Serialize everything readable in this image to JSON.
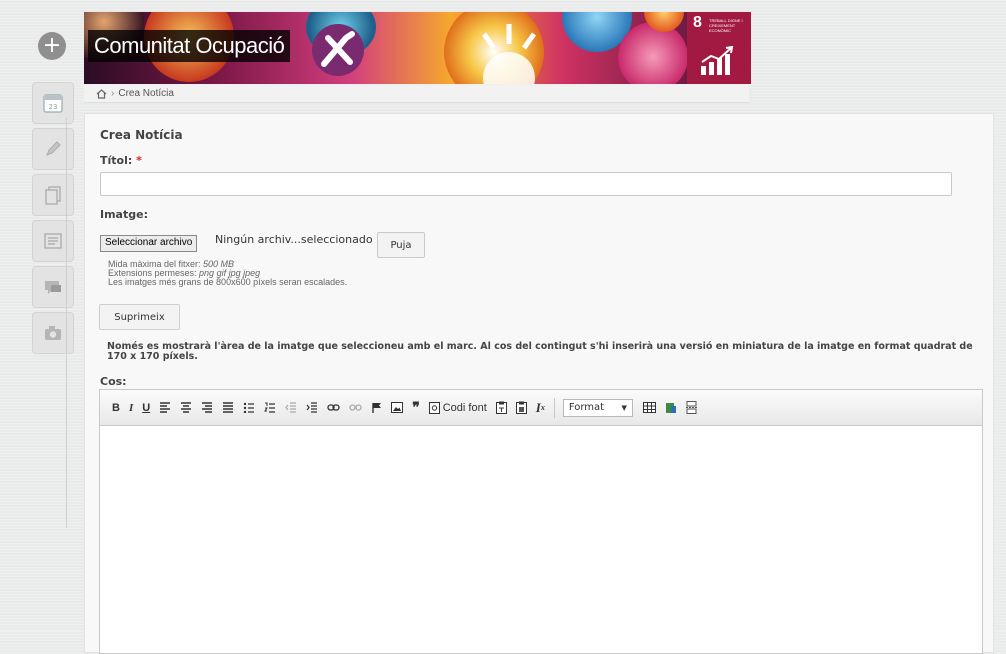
{
  "banner": {
    "title": "Comunitat Ocupació",
    "sdg_number": "8",
    "sdg_text": "TREBALL DIGNE I CREIXEMENT ECONÒMIC"
  },
  "breadcrumb": {
    "current": "Crea Notícia"
  },
  "form": {
    "heading": "Crea Notícia",
    "title_label": "Títol:",
    "required_mark": "*",
    "title_value": "",
    "image_label": "Imatge:",
    "file_button": "Seleccionar archivo",
    "file_status": "Ningún archiv...seleccionado",
    "upload_button": "Puja",
    "hint_size_prefix": "Mida màxima del fitxer: ",
    "hint_size": "500 MB",
    "hint_ext_prefix": "Extensions permeses: ",
    "hint_ext": "png gif jpg jpeg",
    "hint_scale": "Les imatges més grans de 800x600 píxels seran escalades.",
    "delete_button": "Suprimeix",
    "note": "Només es mostrarà l'àrea de la imatge que seleccioneu amb el marc. Al cos del contingut s'hi inserirà una versió en miniatura de la imatge en format quadrat de 170 x 170 píxels.",
    "body_label": "Cos:"
  },
  "toolbar": {
    "bold": "B",
    "italic": "I",
    "underline": "U",
    "source_label": "Codi font",
    "format_label": "Format"
  }
}
